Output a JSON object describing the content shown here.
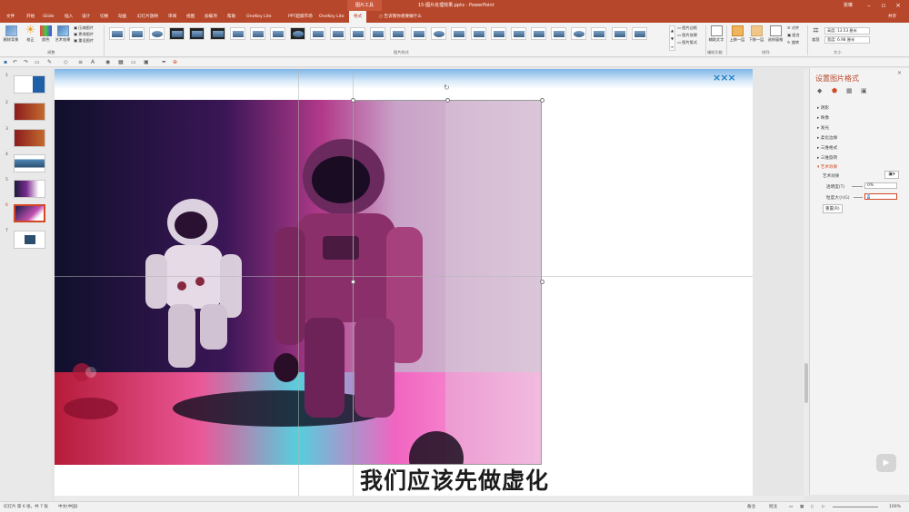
{
  "titlebar": {
    "context_tab": "图片工具",
    "document_title": "15-图片处理效果.pptx - PowerPoint",
    "user": "张琳"
  },
  "tabs": [
    "文件",
    "开始",
    "iSlide",
    "插入",
    "设计",
    "切换",
    "动画",
    "幻灯片放映",
    "审阅",
    "视图",
    "加载项",
    "帮助",
    "OneKey Lite",
    "PPT超级市场",
    "OneKey Lite",
    "格式"
  ],
  "tell_me": "告诉我你想要做什么",
  "share": "共享",
  "ribbon": {
    "remove_bg": "删除背景",
    "corrections": "校正",
    "color": "颜色",
    "artistic": "艺术效果",
    "compress": "压缩图片",
    "change_pic": "更改图片",
    "reset_pic": "重设图片",
    "adjust_group": "调整",
    "styles_group": "图片样式",
    "border": "图片边框",
    "effects": "图片效果",
    "layout": "图片版式",
    "alt_text": "辅助文字",
    "access_group": "辅助功能",
    "bring_forward": "上移一层",
    "send_backward": "下移一层",
    "selection_pane": "选择窗格",
    "align": "对齐",
    "group": "组合",
    "rotate": "旋转",
    "arrange_group": "排列",
    "crop": "裁剪",
    "height": "高度: 13.53 厘米",
    "width": "宽度: 6.98 厘米",
    "size_group": "大小"
  },
  "slides_panel": {
    "numbers": [
      "1",
      "2",
      "3",
      "4",
      "5",
      "6",
      "7"
    ],
    "selected": "6"
  },
  "canvas": {
    "x_marks": "×××"
  },
  "format_pane": {
    "title": "设置图片格式",
    "sections": [
      "阴影",
      "映像",
      "发光",
      "柔化边缘",
      "三维格式",
      "三维旋转"
    ],
    "artistic_section": "艺术效果",
    "artistic_label": "艺术效果",
    "transparency_label": "透明度(T)",
    "transparency_value": "0%",
    "grain_label": "粒度大小(G)",
    "grain_value": "0",
    "reset": "重置(R)"
  },
  "caption": "我们应该先做虚化",
  "status": {
    "slide_info": "幻灯片 第 6 张，共 7 张",
    "language": "中文(中国)",
    "notes": "备注",
    "comments": "批注",
    "zoom": "100%"
  }
}
